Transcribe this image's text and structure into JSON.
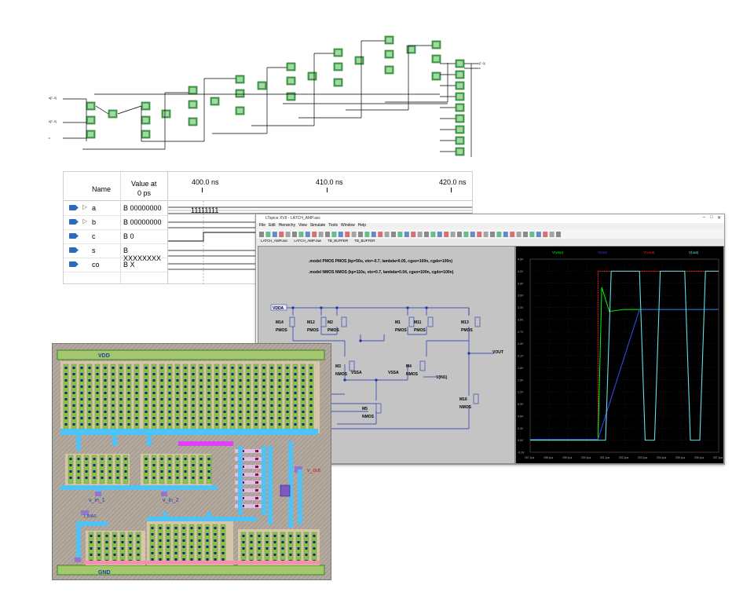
{
  "waveform": {
    "col_name": "Name",
    "col_value": "Value at",
    "col_value_sub": "0 ps",
    "time_marks": [
      "400.0 ns",
      "410.0 ns",
      "420.0 ns"
    ],
    "signals": [
      {
        "name": "a",
        "value": "B 00000000",
        "bus": "11111111",
        "icon": "input-pin-icon"
      },
      {
        "name": "b",
        "value": "B 00000000",
        "icon": "input-pin-icon"
      },
      {
        "name": "c",
        "value": "B 0",
        "icon": "input-pin-icon"
      },
      {
        "name": "s",
        "value": "B XXXXXXXX",
        "icon": "output-pin-icon"
      },
      {
        "name": "co",
        "value": "B X",
        "icon": "output-pin-icon"
      }
    ]
  },
  "ltspice": {
    "title": "LTspice XVII - LATCH_AMP.asc",
    "menu": [
      "File",
      "Edit",
      "Hierarchy",
      "View",
      "Simulate",
      "Tools",
      "Window",
      "Help"
    ],
    "tabs": [
      "LATCH_AMP.asc",
      "LATCH_AMP.raw",
      "TB_BUFFER",
      "TB_BUFFER"
    ],
    "schematic_tab": "LATCH_AMP.asc",
    "plot_tab": "TB_BUFFER",
    "model_pmos": ".model PMOS PMOS (kp=50u, vto=-0.7, lambda=0.05, cgso=100n, cgdo=100n)",
    "model_nmos": ".model NMOS NMOS (kp=110u, vto=0.7, lambda=0.04, cgso=100n, cgdo=100n)",
    "nets": {
      "vdda": "VDDA",
      "vssa": "VSSA",
      "vout": "VOUT",
      "vin": "V(IN1)"
    },
    "devices": [
      {
        "id": "M14",
        "type": "PMOS"
      },
      {
        "id": "M12",
        "type": "PMOS"
      },
      {
        "id": "M2",
        "type": "PMOS"
      },
      {
        "id": "M1",
        "type": "PMOS"
      },
      {
        "id": "M11",
        "type": "PMOS"
      },
      {
        "id": "M13",
        "type": "PMOS"
      },
      {
        "id": "M3",
        "type": "NMOS"
      },
      {
        "id": "M4",
        "type": "NMOS"
      },
      {
        "id": "M5",
        "type": "NMOS"
      },
      {
        "id": "M16",
        "type": "NMOS"
      }
    ],
    "plot_legend": [
      "V(vinp)",
      "V(inn)",
      "V(vout)",
      "V(out)"
    ],
    "plot_colors": [
      "#00ff00",
      "#3050ff",
      "#ff2020",
      "#60e0e0"
    ],
    "y_ticks": [
      "4.5V",
      "4.2V",
      "3.9V",
      "3.6V",
      "3.3V",
      "3.0V",
      "2.7V",
      "2.4V",
      "2.1V",
      "1.8V",
      "1.5V",
      "1.2V",
      "0.9V",
      "0.6V",
      "0.3V",
      "0.0V",
      "-0.3V"
    ],
    "x_ticks": [
      "197.1µs",
      "198.1µs",
      "199.1µs",
      "200.1µs",
      "201.1µs",
      "202.1µs",
      "203.1µs",
      "204.1µs",
      "205.1µs",
      "206.1µs",
      "207.1µs"
    ]
  },
  "layout": {
    "vdd": "VDD",
    "gnd": "GND",
    "vin1": "v_in_1",
    "vin2": "v_in_2",
    "ibias": "I_BIAS",
    "vout": "v_out"
  },
  "schematic": {
    "inputs": [
      "a[7..0]",
      "b[7..0]",
      "c"
    ],
    "outputs": [
      "s[7..0]",
      "co"
    ]
  }
}
